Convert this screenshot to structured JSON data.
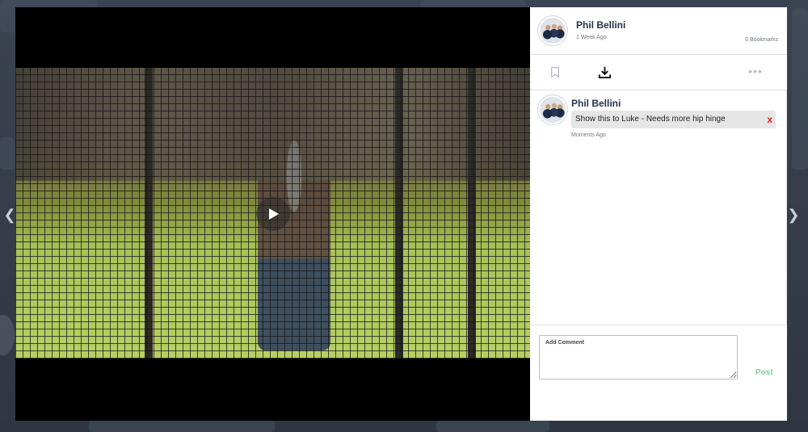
{
  "post": {
    "author": "Phil Bellini",
    "time": "1 Week Ago",
    "bookmarks": "0 Bookmarks"
  },
  "actions": {
    "bookmark_icon": "bookmark-icon",
    "download_icon": "download-icon",
    "more_label": "•••"
  },
  "comments": [
    {
      "author": "Phil Bellini",
      "text": "Show this to Luke - Needs more hip hinge",
      "delete_label": "x",
      "time": "Moments Ago"
    }
  ],
  "composer": {
    "placeholder": "Add Comment",
    "post_label": "Post"
  },
  "navigation": {
    "prev_icon": "chevron-left-icon",
    "next_icon": "chevron-right-icon"
  },
  "colors": {
    "author": "#25344a",
    "delete": "#d9261c",
    "post_button": "#7fcf9b"
  }
}
